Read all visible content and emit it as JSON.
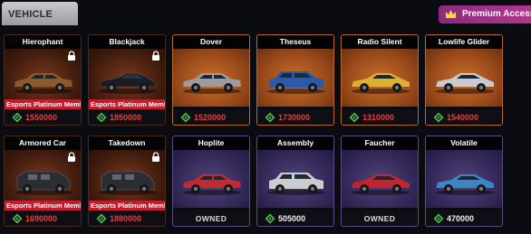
{
  "header": {
    "shop_tab": "VEHICLE SHOP",
    "premium_label": "Premium Access"
  },
  "colors": {
    "price_unaffordable": "#ef3a3a",
    "price_affordable": "#f0f0f0",
    "membership_banner": "#c21d2e",
    "premium": "#b4378f"
  },
  "vehicles": [
    {
      "name": "Hierophant",
      "locked": true,
      "banner": "Esports Platinum Membership",
      "price": "1550000",
      "owned": false,
      "color": "#8a5a2a",
      "type": "sedan"
    },
    {
      "name": "Blackjack",
      "locked": true,
      "banner": "Esports Platinum Membership",
      "price": "1850000",
      "owned": false,
      "color": "#1c1d24",
      "type": "hyper"
    },
    {
      "name": "Dover",
      "locked": false,
      "banner": "",
      "price": "1520000",
      "owned": false,
      "color": "#9a9ca2",
      "type": "sedan"
    },
    {
      "name": "Theseus",
      "locked": false,
      "banner": "",
      "price": "1730000",
      "owned": false,
      "color": "#2d5aa8",
      "type": "suv"
    },
    {
      "name": "Radio Silent",
      "locked": false,
      "banner": "",
      "price": "1310000",
      "owned": false,
      "color": "#d9b233",
      "type": "sport"
    },
    {
      "name": "Lowlife Glider",
      "locked": false,
      "banner": "",
      "price": "1540000",
      "owned": false,
      "color": "#c8ccd2",
      "type": "sport"
    },
    {
      "name": "Armored Car",
      "locked": true,
      "banner": "Esports Platinum Membership",
      "price": "1690000",
      "owned": false,
      "color": "#2c2d33",
      "type": "armored"
    },
    {
      "name": "Takedown",
      "locked": true,
      "banner": "Esports Platinum Membership",
      "price": "1880000",
      "owned": false,
      "color": "#2c2d33",
      "type": "armored"
    },
    {
      "name": "Hoplite",
      "locked": false,
      "banner": "",
      "price": "",
      "owned": true,
      "owned_label": "OWNED",
      "color": "#c22a30",
      "type": "sedan"
    },
    {
      "name": "Assembly",
      "locked": false,
      "banner": "",
      "price": "505000",
      "owned": false,
      "color": "#c9ccd2",
      "type": "suv"
    },
    {
      "name": "Faucher",
      "locked": false,
      "banner": "",
      "price": "",
      "owned": true,
      "owned_label": "OWNED",
      "color": "#c4252c",
      "type": "sport"
    },
    {
      "name": "Volatile",
      "locked": false,
      "banner": "",
      "price": "470000",
      "owned": false,
      "color": "#3a86c8",
      "type": "sport"
    }
  ]
}
